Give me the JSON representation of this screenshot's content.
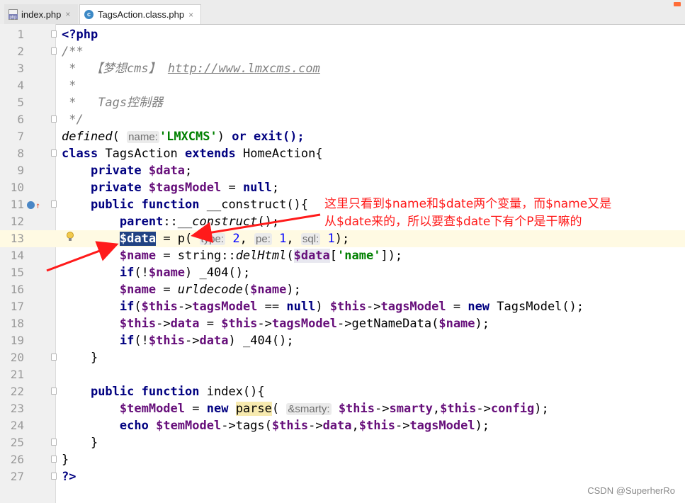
{
  "tabs": [
    {
      "icon": "php-file-icon",
      "label": "index.php",
      "active": false
    },
    {
      "icon": "class-icon",
      "label": "TagsAction.class.php",
      "active": true
    }
  ],
  "tab_close_glyph": "×",
  "class_icon_letter": "c",
  "php_icon_text": "php",
  "line_numbers": [
    "1",
    "2",
    "3",
    "4",
    "5",
    "6",
    "7",
    "8",
    "9",
    "10",
    "11",
    "12",
    "13",
    "14",
    "15",
    "16",
    "17",
    "18",
    "19",
    "20",
    "21",
    "22",
    "23",
    "24",
    "25",
    "26",
    "27"
  ],
  "code": {
    "l1": "<?php",
    "l2": "/**",
    "l3a": " *  【梦想cms】 ",
    "l3b": "http://www.lmxcms.com",
    "l4": " *",
    "l5": " *   Tags控制器",
    "l6": " */",
    "l7a": "defined",
    "l7b": "name:",
    "l7c": "'LMXCMS'",
    "l7d": "or",
    "l7e": "exit();",
    "l8a": "class",
    "l8b": "TagsAction",
    "l8c": "extends",
    "l8d": "HomeAction{",
    "l9a": "private",
    "l9b": "$data",
    "l10a": "private",
    "l10b": "$tagsModel",
    "l10c": "null",
    "l11a": "public function",
    "l11b": "__construct(){",
    "l12a": "parent",
    "l12b": "__construct",
    "l13a": "$data",
    "l13b": "p",
    "l13c": "type:",
    "l13d": "2",
    "l13e": "pe:",
    "l13f": "1",
    "l13g": "sql:",
    "l13h": "1",
    "l14a": "$name",
    "l14b": "string::",
    "l14c": "delHtml",
    "l14d": "$data",
    "l14e": "'name'",
    "l15a": "if",
    "l15b": "$name",
    "l15c": "_404();",
    "l16a": "$name",
    "l16b": "urldecode",
    "l16c": "$name",
    "l17a": "if",
    "l17b": "$this",
    "l17c": "tagsModel",
    "l17d": "null",
    "l17e": "$this",
    "l17f": "tagsModel",
    "l17g": "new",
    "l17h": "TagsModel();",
    "l18a": "$this",
    "l18b": "data",
    "l18c": "$this",
    "l18d": "tagsModel",
    "l18e": "getNameData(",
    "l18f": "$name",
    "l19a": "if",
    "l19b": "$this",
    "l19c": "data",
    "l19d": "_404();",
    "l20": "}",
    "l22a": "public function",
    "l22b": "index(){",
    "l23a": "$temModel",
    "l23b": "new",
    "l23c": "parse",
    "l23d": "&smarty:",
    "l23e": "$this",
    "l23f": "smarty",
    "l23g": "$this",
    "l23h": "config",
    "l24a": "echo",
    "l24b": "$temModel",
    "l24c": "tags(",
    "l24d": "$this",
    "l24e": "data",
    "l24f": "$this",
    "l24g": "tagsModel",
    "l25": "}",
    "l26": "}",
    "l27": "?>"
  },
  "annotation": {
    "line1": "这里只看到$name和$date两个变量，而$name又是",
    "line2": "从$date来的，所以要查$date下有个P是干嘛的",
    "color": "#ff1a1a"
  },
  "watermark": "CSDN @SuperherRo",
  "colors": {
    "keyword": "#000080",
    "string": "#008000",
    "variable": "#660e7a",
    "comment": "#808080",
    "number": "#0000ff",
    "selection": "#214283"
  }
}
